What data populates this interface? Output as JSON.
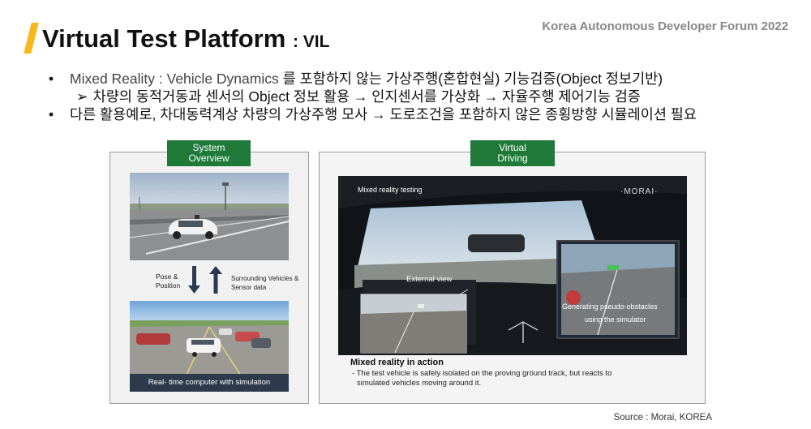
{
  "header": {
    "title": "Virtual Test Platform",
    "title_suffix": ": VIL",
    "forum": "Korea Autonomous Developer Forum 2022"
  },
  "bullets": [
    {
      "lite": "Mixed Reality : Vehicle Dynamics",
      "text": " 를 포함하지 않는 가상주행(혼합현실) 기능검증(Object 정보기반)"
    },
    {
      "marker": "➢",
      "text": "차량의 동적거동과 센서의 Object  정보 활용 → 인지센서를 가상화 → 자율주행 제어기능 검증"
    },
    {
      "text": "다른 활용예로, 차대동력계상 차량의 가상주행 모사 → 도로조건을 포함하지 않은 종횡방향 시뮬레이션 필요"
    }
  ],
  "left_panel": {
    "tag_line1": "System",
    "tag_line2": "Overview",
    "pose_label_line1": "Pose &",
    "pose_label_line2": "Position",
    "surround_label_line1": "Surrounding Vehicles &",
    "surround_label_line2": "Sensor data",
    "sim_caption": "Real- time computer with simulation"
  },
  "right_panel": {
    "tag_line1": "Virtual",
    "tag_line2": "Driving",
    "overlay_mr": "Mixed reality testing",
    "overlay_brand": "·MORAI·",
    "overlay_external": "External view",
    "overlay_gen_line1": "Generating pseudo-obstacles",
    "overlay_gen_line2": "using the simulator",
    "caption_title": "Mixed reality in action",
    "caption_line1": "- The test vehicle is safely isolated on the proving ground track, but reacts to",
    "caption_line2": "simulated vehicles moving around it."
  },
  "source": "Source : Morai, KOREA",
  "colors": {
    "accent": "#f6b81c",
    "tag_green": "#1f7a3a",
    "forum_gray": "#888888"
  }
}
